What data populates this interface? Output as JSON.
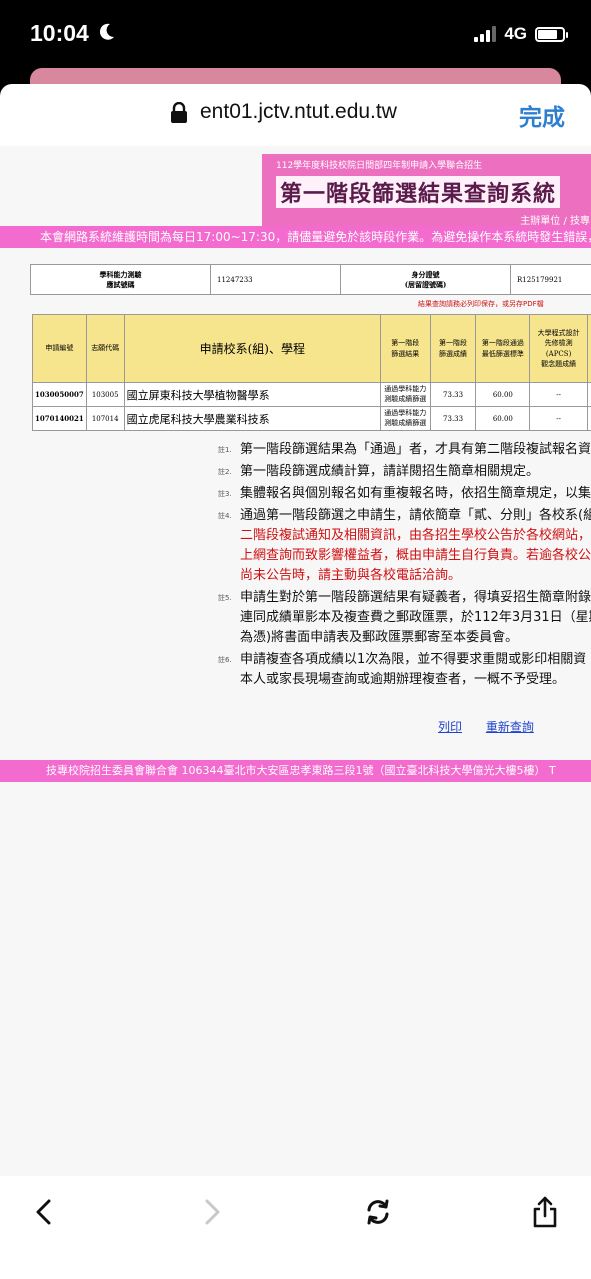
{
  "status": {
    "time": "10:04",
    "network": "4G"
  },
  "browser": {
    "url": "ent01.jctv.ntut.edu.tw",
    "done_label": "完成"
  },
  "header": {
    "subtitle": "112學年度科技校院日間部四年制申請入學聯合招生",
    "title": "第一階段篩選結果查詢系統",
    "org": "主辦單位 / 技專"
  },
  "maintenance": "本會網路系統維護時間為每日17:00~17:30，請儘量避免於該時段作業。為避免操作本系統時發生錯誤，建",
  "info": {
    "exam_label_1": "學科能力測驗",
    "exam_label_2": "應試號碼",
    "exam_no": "11247233",
    "id_label_1": "身分證號",
    "id_label_2": "(居留證號碼)",
    "id_no": "R125179921"
  },
  "save_note": "結果查詢請務必列印保存，或另存PDF檔",
  "table": {
    "headers": {
      "app_no": "申請編號",
      "code": "志願代碼",
      "school": "申請校系(組)、學程",
      "result": "第一階段\n篩選結果",
      "score": "第一階段\n篩選成績",
      "min": "第一階段通過\n最低篩選標準",
      "apcs": "大學程式設計\n先修檢測\n(APCS)\n觀念題成績"
    },
    "rows": [
      {
        "app_no": "1030050007",
        "code": "103005",
        "school": "國立屏東科技大學植物醫學系",
        "result": "通過學科能力\n測驗成績篩選",
        "score": "73.33",
        "min": "60.00",
        "apcs": "--"
      },
      {
        "app_no": "1070140021",
        "code": "107014",
        "school": "國立虎尾科技大學農業科技系",
        "result": "通過學科能力\n測驗成績篩選",
        "score": "73.33",
        "min": "60.00",
        "apcs": "--"
      }
    ]
  },
  "notes": [
    {
      "num": "註1.",
      "lines": [
        "第一階段篩選結果為「通過」者，才具有第二階段複試報名資"
      ]
    },
    {
      "num": "註2.",
      "lines": [
        "第一階段篩選成績計算，請詳閱招生簡章相關規定。"
      ]
    },
    {
      "num": "註3.",
      "lines": [
        "集體報名與個別報名如有重複報名時，依招生簡章規定，以集"
      ]
    },
    {
      "num": "註4.",
      "lines": [
        "通過第一階段篩選之申請生，請依簡章「貳、分則」各校系(組",
        "二階段複試通知及相關資訊，由各招生學校公告於各校網站，",
        "上網查詢而致影響權益者，概由申請生自行負責。若逾各校公",
        "尚未公告時，請主動與各校電話洽詢。"
      ]
    },
    {
      "num": "註5.",
      "lines": [
        "申請生對於第一階段篩選結果有疑義者，得填妥招生簡章附錄",
        "連同成績單影本及複查費之郵政匯票，於112年3月31日（星期",
        "為憑)將書面申請表及郵政匯票郵寄至本委員會。"
      ]
    },
    {
      "num": "註6.",
      "lines": [
        "申請複查各項成績以1次為限，並不得要求重閱或影印相關資",
        "本人或家長現場查詢或逾期辦理複查者，一概不予受理。"
      ]
    }
  ],
  "links": {
    "print": "列印",
    "requery": "重新查詢"
  },
  "footer": "技專校院招生委員會聯合會 106344臺北市大安區忠孝東路三段1號（國立臺北科技大學億光大樓5樓） T"
}
